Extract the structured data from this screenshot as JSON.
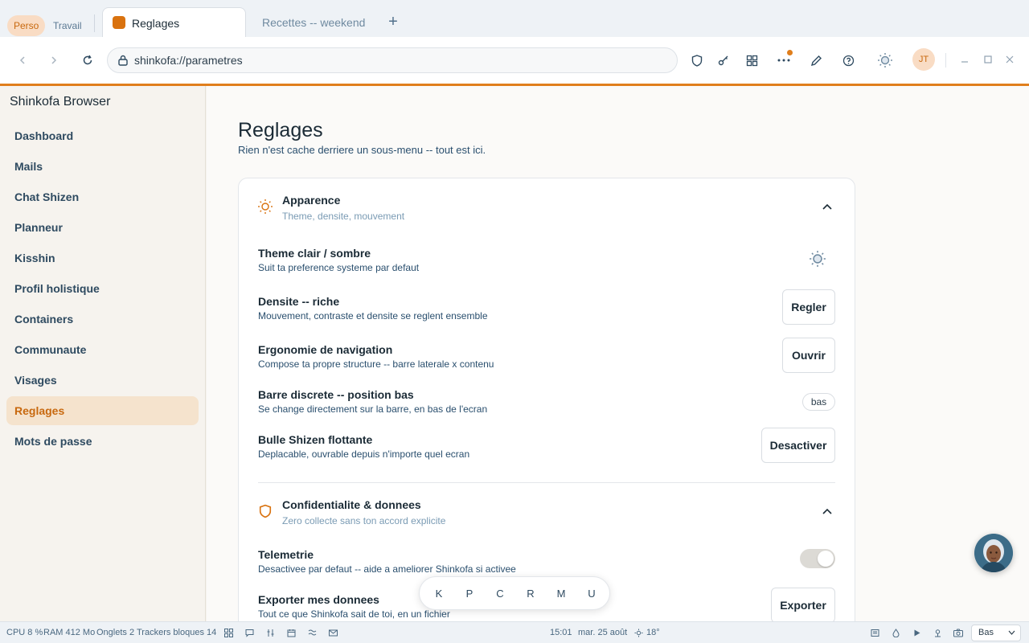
{
  "profiles": {
    "perso": "Perso",
    "travail": "Travail"
  },
  "tabs": [
    {
      "title": "Reglages",
      "active": true
    },
    {
      "title": "Recettes -- weekend",
      "active": false
    }
  ],
  "toolbar": {
    "url": "shinkofa://parametres",
    "avatar_initials": "JT",
    "icons": [
      "back-icon",
      "forward-icon",
      "reload-icon",
      "lock-icon",
      "shield-icon",
      "key-icon",
      "extensions-icon",
      "more-icon",
      "edit-icon",
      "help-icon",
      "theme-icon",
      "minimize-icon",
      "maximize-icon",
      "close-icon"
    ]
  },
  "sidebar": {
    "brand": "Shinkofa Browser",
    "items": [
      {
        "label": "Dashboard",
        "active": false
      },
      {
        "label": "Mails",
        "active": false
      },
      {
        "label": "Chat Shizen",
        "active": false
      },
      {
        "label": "Planneur",
        "active": false
      },
      {
        "label": "Kisshin",
        "active": false
      },
      {
        "label": "Profil holistique",
        "active": false
      },
      {
        "label": "Containers",
        "active": false
      },
      {
        "label": "Communaute",
        "active": false
      },
      {
        "label": "Visages",
        "active": false
      },
      {
        "label": "Reglages",
        "active": true
      },
      {
        "label": "Mots de passe",
        "active": false
      }
    ]
  },
  "page": {
    "title": "Reglages",
    "subtitle": "Rien n'est cache derriere un sous-menu -- tout est ici."
  },
  "sections": {
    "appearance": {
      "title": "Apparence",
      "subtitle": "Theme, densite, mouvement",
      "rows": {
        "theme": {
          "title": "Theme clair / sombre",
          "desc": "Suit ta preference systeme par defaut"
        },
        "density": {
          "title": "Densite -- riche",
          "desc": "Mouvement, contraste et densite se reglent ensemble",
          "button": "Regler"
        },
        "ergonomics": {
          "title": "Ergonomie de navigation",
          "desc": "Compose ta propre structure -- barre laterale x contenu",
          "button": "Ouvrir"
        },
        "bar": {
          "title": "Barre discrete -- position bas",
          "desc": "Se change directement sur la barre, en bas de l'ecran",
          "chip": "bas"
        },
        "bubble": {
          "title": "Bulle Shizen flottante",
          "desc": "Deplacable, ouvrable depuis n'importe quel ecran",
          "button": "Desactiver"
        }
      }
    },
    "privacy": {
      "title": "Confidentialite & donnees",
      "subtitle": "Zero collecte sans ton accord explicite",
      "rows": {
        "telemetry": {
          "title": "Telemetrie",
          "desc": "Desactivee par defaut -- aide a ameliorer Shinkofa si activee",
          "enabled": false
        },
        "export": {
          "title": "Exporter mes donnees",
          "desc": "Tout ce que Shinkofa sait de toi, en un fichier",
          "button": "Exporter"
        }
      }
    }
  },
  "dock": {
    "keys": [
      "K",
      "P",
      "C",
      "R",
      "M",
      "U"
    ]
  },
  "statusbar": {
    "cpu": "CPU 8 %",
    "ram": "RAM 412 Mo",
    "tabs": "Onglets 2",
    "trackers": "Trackers bloques 14",
    "time": "15:01",
    "date": "mar. 25 août",
    "weather": "18°",
    "position_select": "Bas"
  },
  "colors": {
    "accent": "#e07e1c",
    "active_bg": "#f5e3cd",
    "active_text": "#c8690f"
  }
}
